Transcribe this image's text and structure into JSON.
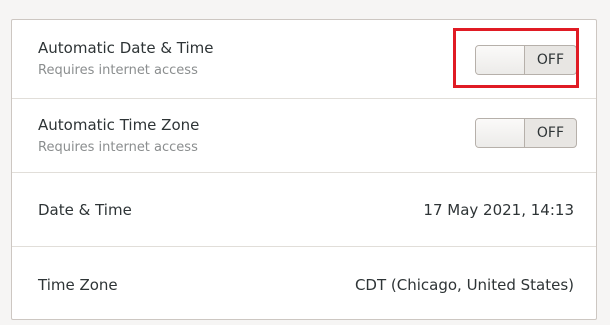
{
  "settings": {
    "automatic_date_time": {
      "title": "Automatic Date & Time",
      "subtitle": "Requires internet access",
      "toggle_label": "OFF",
      "enabled": false
    },
    "automatic_time_zone": {
      "title": "Automatic Time Zone",
      "subtitle": "Requires internet access",
      "toggle_label": "OFF",
      "enabled": false
    },
    "date_time": {
      "title": "Date & Time",
      "value": "17 May 2021, 14:13"
    },
    "time_zone": {
      "title": "Time Zone",
      "value": "CDT (Chicago, United States)"
    }
  },
  "colors": {
    "highlight": "#e01b24",
    "panel_background": "#ffffff",
    "window_background": "#f6f5f4"
  }
}
